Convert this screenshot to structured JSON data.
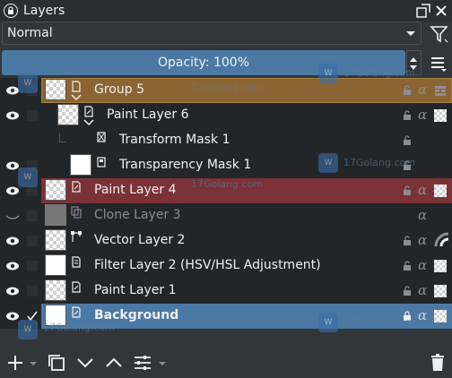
{
  "titlebar": {
    "title": "Layers"
  },
  "blend": {
    "mode": "Normal"
  },
  "opacity": {
    "label": "Opacity: 100%",
    "value": 100
  },
  "layers": [
    {
      "name": "Group 5",
      "type": "group",
      "visible": true,
      "selected_color": "#8a6533"
    },
    {
      "name": "Paint Layer 6",
      "type": "paint",
      "visible": true
    },
    {
      "name": "Transform Mask 1",
      "type": "transform-mask",
      "visible": false
    },
    {
      "name": "Transparency Mask 1",
      "type": "transparency-mask",
      "visible": true
    },
    {
      "name": "Paint Layer 4",
      "type": "paint",
      "visible": true,
      "selected_color": "#7a3236"
    },
    {
      "name": "Clone Layer 3",
      "type": "clone",
      "visible": false
    },
    {
      "name": "Vector Layer 2",
      "type": "vector",
      "visible": true
    },
    {
      "name": "Filter Layer 2 (HSV/HSL Adjustment)",
      "type": "filter",
      "visible": true
    },
    {
      "name": "Paint Layer 1",
      "type": "paint",
      "visible": true
    },
    {
      "name": "Background",
      "type": "paint",
      "visible": true,
      "selected_color": "#4b79a3",
      "locked": true
    }
  ],
  "watermarks": [
    "17Golang.com",
    "17Golang.com",
    "17Golang.com",
    "17Golang.com",
    "17Golang.com",
    "17Golang.com"
  ],
  "colors": {
    "accent": "#4b79a3",
    "group_highlight": "#8a6533",
    "paint4_highlight": "#7a3236",
    "panel_bg": "#31363b",
    "list_bg": "#232629"
  }
}
